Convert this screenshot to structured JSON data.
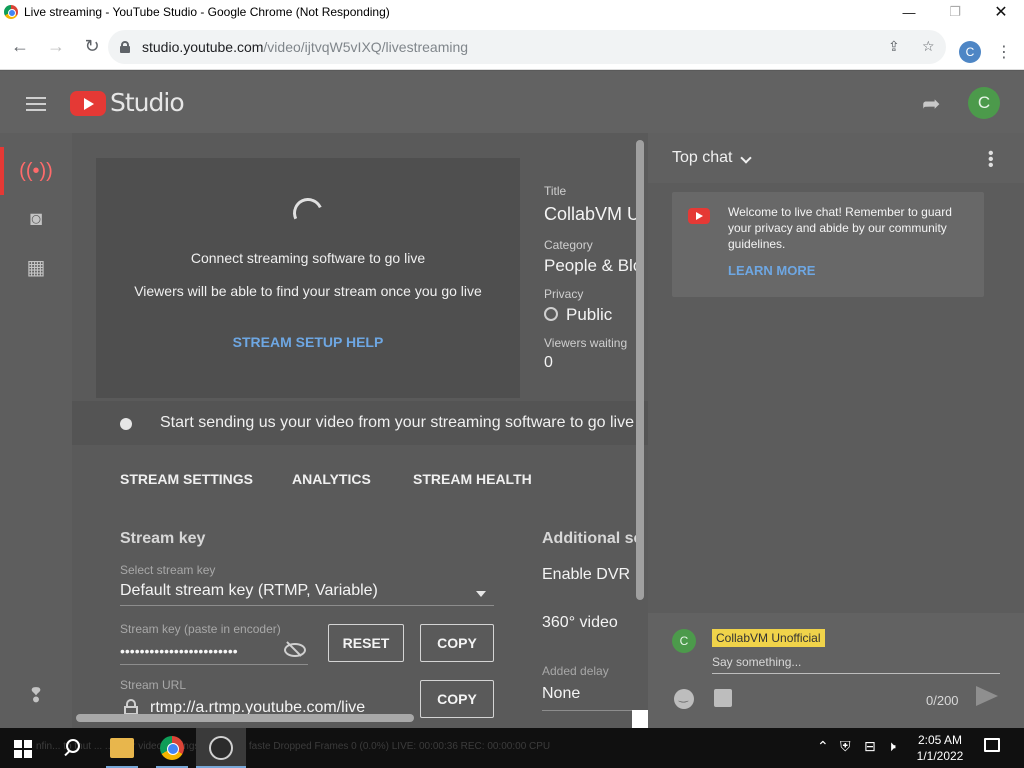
{
  "window": {
    "title": "Live streaming - YouTube Studio - Google Chrome (Not Responding)",
    "minimize": "—",
    "maximize": "❐",
    "close": "✕"
  },
  "browser": {
    "url_host": "studio.youtube.com",
    "url_path": "/video/ijtvqW5vIXQ/livestreaming",
    "profile_initial": "C"
  },
  "studio": {
    "brand": "Studio",
    "avatar_initial": "C"
  },
  "preview": {
    "line1": "Connect streaming software to go live",
    "line2": "Viewers will be able to find your stream once you go live",
    "help_link": "STREAM SETUP HELP"
  },
  "meta": {
    "title_label": "Title",
    "title_value": "CollabVM U",
    "category_label": "Category",
    "category_value": "People & Blo",
    "privacy_label": "Privacy",
    "privacy_value": "Public",
    "viewers_label": "Viewers waiting",
    "viewers_value": "0"
  },
  "status": {
    "text": "Start sending us your video from your streaming software to go live"
  },
  "tabs": [
    {
      "label": "STREAM SETTINGS"
    },
    {
      "label": "ANALYTICS"
    },
    {
      "label": "STREAM HEALTH"
    }
  ],
  "stream_key": {
    "section_title": "Stream key",
    "select_hint": "Select stream key",
    "select_value": "Default stream key (RTMP, Variable)",
    "key_hint": "Stream key (paste in encoder)",
    "key_masked": "••••••••••••••••••••••••",
    "reset_label": "RESET",
    "copy_label": "COPY",
    "url_hint": "Stream URL",
    "url_value": "rtmp://a.rtmp.youtube.com/live",
    "copy_url_label": "COPY"
  },
  "additional": {
    "section_title": "Additional se",
    "dvr": "Enable DVR",
    "video360": "360° video",
    "delay_hint": "Added delay",
    "delay_value": "None"
  },
  "chat": {
    "title": "Top chat",
    "welcome": "Welcome to live chat! Remember to guard your privacy and abide by our community guidelines.",
    "learn_more": "LEARN MORE",
    "author_initial": "C",
    "author": "CollabVM Unofficial",
    "placeholder": "Say something...",
    "char_count": "0/200"
  },
  "taskbar": {
    "ghost_text": "nfin...      to tnut ...  ... your video settings or using a faste     Dropped Frames 0 (0.0%)      LIVE: 00:00:36      REC: 00:00:00      CPU",
    "time": "2:05 AM",
    "date": "1/1/2022"
  },
  "colors": {
    "accent_blue": "#6ea7e3",
    "youtube_red": "#e53935",
    "avatar_green": "#4c9a4b",
    "author_badge": "#f0d34a"
  }
}
